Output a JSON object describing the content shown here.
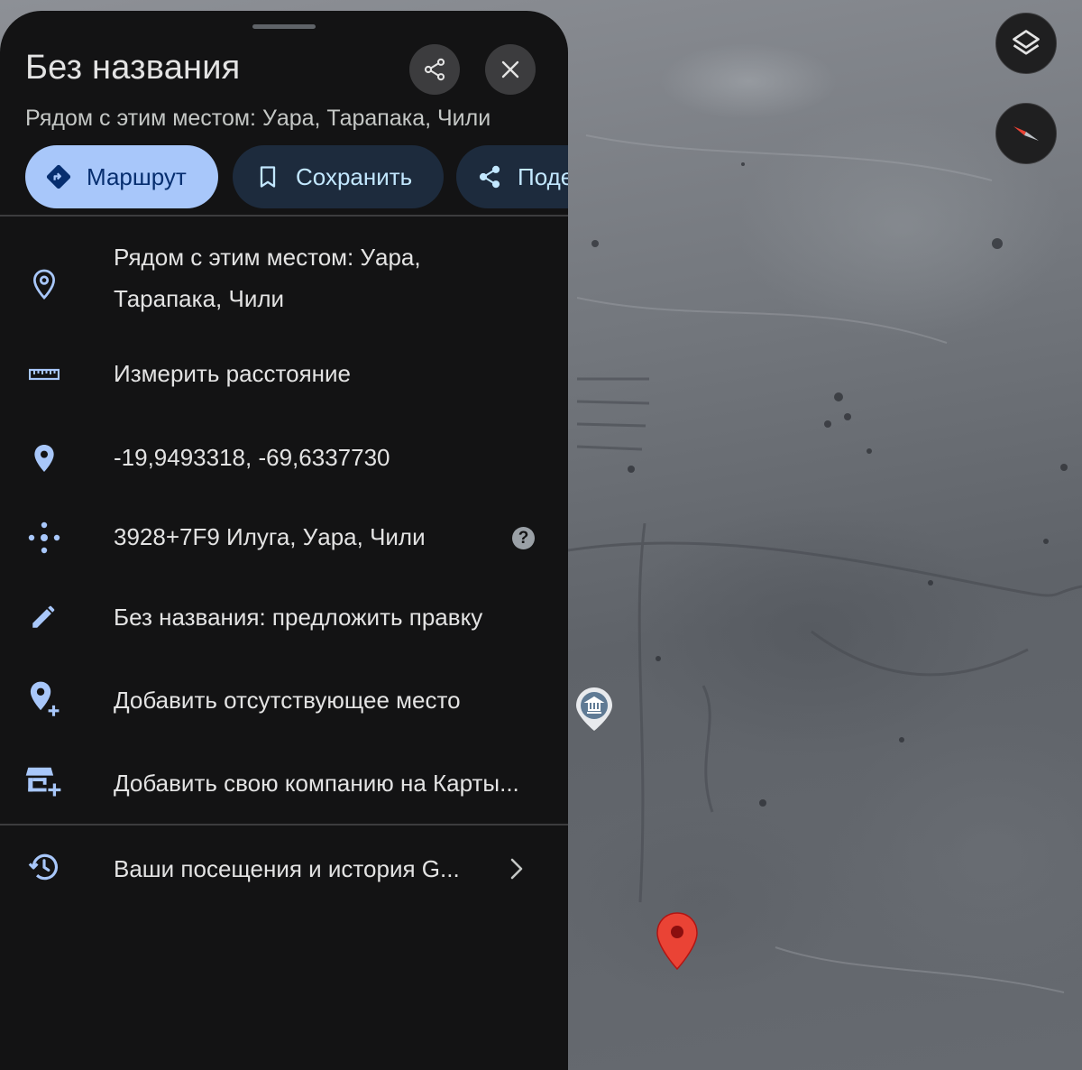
{
  "place": {
    "title": "Без названия",
    "subtitle": "Рядом с этим местом: Уара, Тарапака, Чили"
  },
  "actions": {
    "route_label": "Маршрут",
    "save_label": "Сохранить",
    "share_label": "Поде"
  },
  "details": {
    "address_line1": "Рядом с этим местом: Уара,",
    "address_line2": "Тарапака, Чили",
    "measure_label": "Измерить расстояние",
    "coordinates": "-19,9493318, -69,6337730",
    "plus_code": "3928+7F9 Илуга, Уара, Чили",
    "help_glyph": "?",
    "suggest_edit_label": "Без названия: предложить правку",
    "add_place_label": "Добавить отсутствующее место",
    "add_business_label": "Добавить свою компанию на Карты...",
    "history_label": "Ваши посещения и история G..."
  },
  "icons": {
    "share_round": "share-icon",
    "close_round": "close-icon",
    "route": "directions-icon",
    "save": "bookmark-icon",
    "share": "share-icon",
    "address": "location-outline-icon",
    "measure": "ruler-icon",
    "coordinates": "location-pin-icon",
    "plus_code": "plus-code-icon",
    "suggest_edit": "pencil-icon",
    "add_place": "add-location-icon",
    "add_business": "add-business-icon",
    "history": "history-icon",
    "history_chevron": "chevron-right-icon",
    "map_layers": "layers-icon",
    "map_compass": "compass-icon",
    "map_poi": "museum-poi-icon",
    "map_pin": "red-marker-icon"
  },
  "colors": {
    "panel_bg": "#131314",
    "route_chip_bg": "#a8c7fa",
    "secondary_chip_bg": "#1d2b3d",
    "icon_blue": "#a8c7fa",
    "marker_red": "#ea4335"
  }
}
